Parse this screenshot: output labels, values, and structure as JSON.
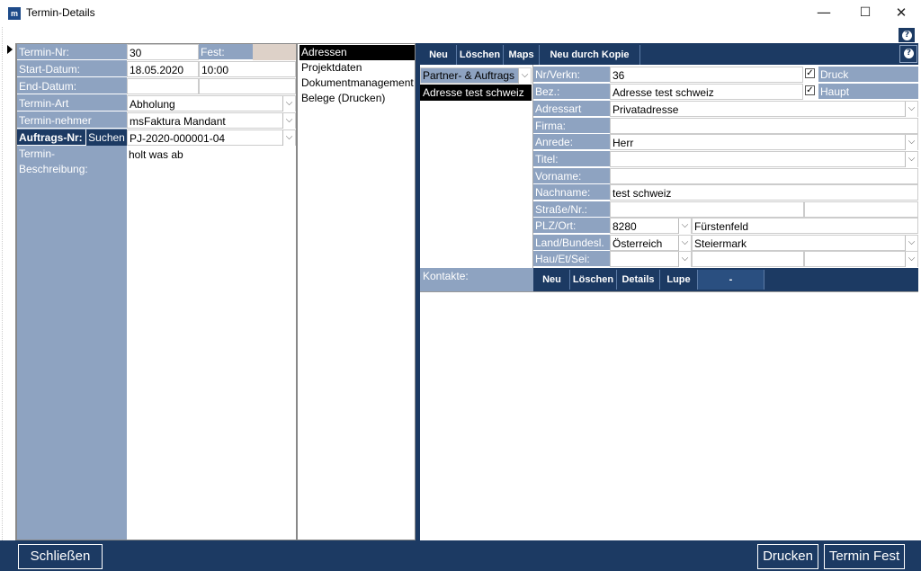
{
  "window": {
    "title": "Termin-Details",
    "app_icon": "m",
    "minimize": "—",
    "maximize": "☐",
    "close": "✕"
  },
  "form": {
    "termin_nr_label": "Termin-Nr:",
    "termin_nr_value": "30",
    "fest_label": "Fest:",
    "start_datum_label": "Start-Datum:",
    "start_datum_value": "18.05.2020",
    "start_time_value": "10:00",
    "end_datum_label": "End-Datum:",
    "termin_art_label": "Termin-Art",
    "termin_art_value": "Abholung",
    "termin_nehmer_label": "Termin-nehmer",
    "termin_nehmer_value": "msFaktura Mandant",
    "auftrags_nr_label": "Auftrags-Nr:",
    "suchen_label": "Suchen",
    "auftrags_nr_value": "PJ-2020-000001-04",
    "beschreibung_label_1": "Termin-",
    "beschreibung_label_2": "Beschreibung:",
    "beschreibung_value": "holt was ab"
  },
  "mid_list": [
    "Adressen",
    "Projektdaten",
    "Dokumentmanagement",
    "Belege (Drucken)"
  ],
  "toolbar": {
    "neu": "Neu",
    "loeschen": "Löschen",
    "maps": "Maps",
    "neu_durch_kopie": "Neu durch Kopie"
  },
  "partner": {
    "dropdown_label": "Partner- & Auftrags",
    "selected_item": "Adresse test schweiz"
  },
  "address": {
    "nr_label": "Nr/Verkn:",
    "nr_value": "36",
    "druck_label": "Druck",
    "druck_checked": "✓",
    "bez_label": "Bez.:",
    "bez_value": "Adresse test schweiz",
    "haupt_label": "Haupt",
    "haupt_checked": "✓",
    "adressart_label": "Adressart",
    "adressart_value": "Privatadresse",
    "firma_label": "Firma:",
    "anrede_label": "Anrede:",
    "anrede_value": "Herr",
    "titel_label": "Titel:",
    "vorname_label": "Vorname:",
    "nachname_label": "Nachname:",
    "nachname_value": "test schweiz",
    "strasse_label": "Straße/Nr.:",
    "plz_label": "PLZ/Ort:",
    "plz_value": "8280",
    "ort_value": "Fürstenfeld",
    "land_label": "Land/Bundesl.",
    "land_value": "Österreich",
    "bundesland_value": "Steiermark",
    "hau_label": "Hau/Et/Sei:"
  },
  "kontakte": {
    "label": "Kontakte:",
    "neu": "Neu",
    "loeschen": "Löschen",
    "details": "Details",
    "lupe": "Lupe",
    "extra": "-"
  },
  "bottom": {
    "schliessen": "Schließen",
    "drucken": "Drucken",
    "termin_fest": "Termin Fest"
  },
  "colors": {
    "navy": "#1c3a63",
    "label_blue": "#8ea3c1",
    "fest_box": "#ddd1c8"
  }
}
